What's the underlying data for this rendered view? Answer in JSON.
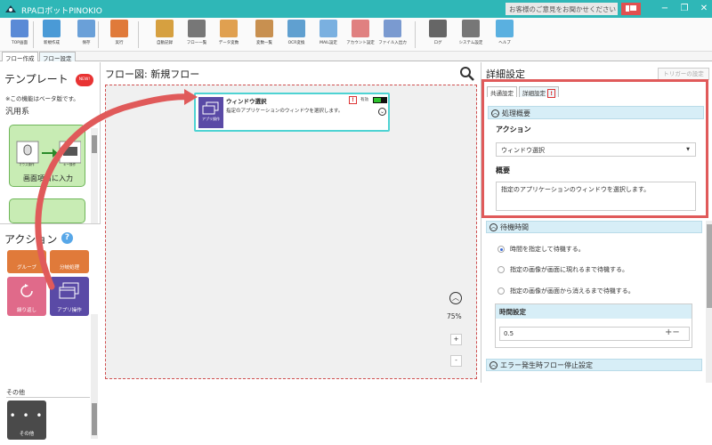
{
  "app": {
    "title": "RPAロボットPINOKIO",
    "feedback": "お客様のご意見をお聞かせください"
  },
  "toolbar": [
    {
      "label": "TOP画面",
      "icon": "top-screen-icon"
    },
    {
      "label": "新規作成",
      "icon": "new-file-icon"
    },
    {
      "label": "保存",
      "icon": "save-icon"
    },
    {
      "label": "実行",
      "icon": "run-icon"
    },
    {
      "label": "自動記録",
      "icon": "auto-record-icon"
    },
    {
      "label": "フロー一覧",
      "icon": "flow-list-icon"
    },
    {
      "label": "データ変数",
      "icon": "data-variable-icon"
    },
    {
      "label": "変数一覧",
      "icon": "variable-list-icon"
    },
    {
      "label": "OCR変換",
      "icon": "ocr-icon"
    },
    {
      "label": "MAIL設定",
      "icon": "mail-icon"
    },
    {
      "label": "アカウント設定",
      "icon": "account-icon"
    },
    {
      "label": "ファイル入出力",
      "icon": "file-io-icon"
    },
    {
      "label": "ログ",
      "icon": "log-icon"
    },
    {
      "label": "システム設定",
      "icon": "system-settings-icon"
    },
    {
      "label": "ヘルプ",
      "icon": "help-icon"
    }
  ],
  "tabs": {
    "flow_create": "フロー作成",
    "flow_settings": "フロー設定"
  },
  "left": {
    "template_title": "テンプレート",
    "new_badge": "NEW!",
    "beta_note": "※この機能はベータ版です。",
    "general": "汎用系",
    "template1_label": "画面項目に入力",
    "template1_sub1": "マウス操作",
    "template1_sub2": "キー操作",
    "actions_title": "アクション",
    "help": "?",
    "tiles": {
      "group": "グループ",
      "branch": "分岐処理",
      "repeat": "繰り返し",
      "app_op": "アプリ操作",
      "other_tile": "その他"
    },
    "other_section": "その他"
  },
  "flow": {
    "title": "フロー図:  新規フロー",
    "node": {
      "title": "ウィンドウ選択",
      "desc": "指定のアプリケーションのウィンドウを選択します。",
      "enabled": "有効",
      "icon_label": "アプリ操作",
      "warn": "!"
    },
    "zoom": "75%",
    "zoom_in": "+",
    "zoom_out": "-"
  },
  "detail": {
    "title": "詳細設定",
    "trigger": "トリガーの設定",
    "tab_common": "共通設定",
    "tab_detail": "詳細設定",
    "tab_warn": "!",
    "section_process": "処理概要",
    "action_label": "アクション",
    "action_value": "ウィンドウ選択",
    "summary_label": "概要",
    "summary_value": "指定のアプリケーションのウィンドウを選択します。",
    "section_wait": "待機時間",
    "radio1": "時間を指定して待機する。",
    "radio2": "指定の画像が画面に現れるまで待機する。",
    "radio3": "指定の画像が画面から消えるまで待機する。",
    "wait_label": "時間設定",
    "wait_value": "0.5",
    "section_error": "エラー発生時フロー停止設定"
  },
  "colors": {
    "teal": "#2fb7b7",
    "red": "#e05a5a",
    "section": "#d7eef7",
    "app_op": "#5a4aa6",
    "repeat": "#e06a8a",
    "template": "#c8ecb4"
  }
}
